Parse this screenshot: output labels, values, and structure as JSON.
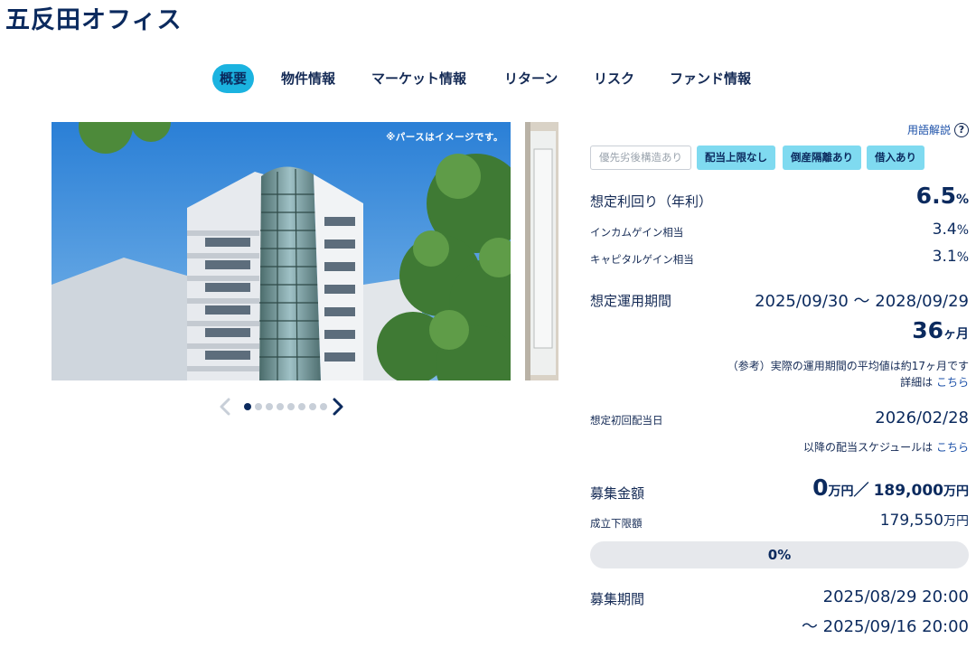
{
  "page": {
    "title": "五反田オフィス"
  },
  "tabs": [
    {
      "label": "概要",
      "active": true
    },
    {
      "label": "物件情報"
    },
    {
      "label": "マーケット情報"
    },
    {
      "label": "リターン"
    },
    {
      "label": "リスク"
    },
    {
      "label": "ファンド情報"
    }
  ],
  "carousel": {
    "image_note": "※パースはイメージです。",
    "dot_count": 8,
    "active_index": 0
  },
  "glossary": {
    "label": "用語解説",
    "icon": "question-circle-icon"
  },
  "tags": [
    {
      "label": "優先劣後構造あり",
      "active": false
    },
    {
      "label": "配当上限なし",
      "active": true
    },
    {
      "label": "倒産隔離あり",
      "active": true
    },
    {
      "label": "借入あり",
      "active": true
    }
  ],
  "yield": {
    "label": "想定利回り（年利）",
    "value": "6.5",
    "unit": "%",
    "income_label": "インカムゲイン相当",
    "income_value": "3.4",
    "income_unit": "%",
    "capital_label": "キャピタルゲイン相当",
    "capital_value": "3.1",
    "capital_unit": "%"
  },
  "period": {
    "label": "想定運用期間",
    "range": "2025/09/30 〜 2028/09/29",
    "months": "36",
    "months_unit": "ヶ月",
    "reference_note": "（参考）実際の運用期間の平均値は約17ヶ月です",
    "detail_prefix": "詳細は",
    "detail_link": "こちら"
  },
  "first_dividend": {
    "label": "想定初回配当日",
    "date": "2026/02/28",
    "schedule_prefix": "以降の配当スケジュールは",
    "schedule_link": "こちら"
  },
  "funding": {
    "label": "募集金額",
    "raised": "0",
    "raised_unit": "万円",
    "separator": "／",
    "target": "189,000",
    "target_unit": "万円",
    "min_label": "成立下限額",
    "min_value": "179,550",
    "min_unit": "万円",
    "progress_text": "0%",
    "progress_value": 0
  },
  "recruit_period": {
    "label": "募集期間",
    "start": "2025/08/29 20:00",
    "end": "〜 2025/09/16 20:00"
  },
  "colors": {
    "accent": "#1bb3e0",
    "tag_bg": "#7fdaf0",
    "navy": "#0b2a5e",
    "link": "#1a4fa8"
  }
}
